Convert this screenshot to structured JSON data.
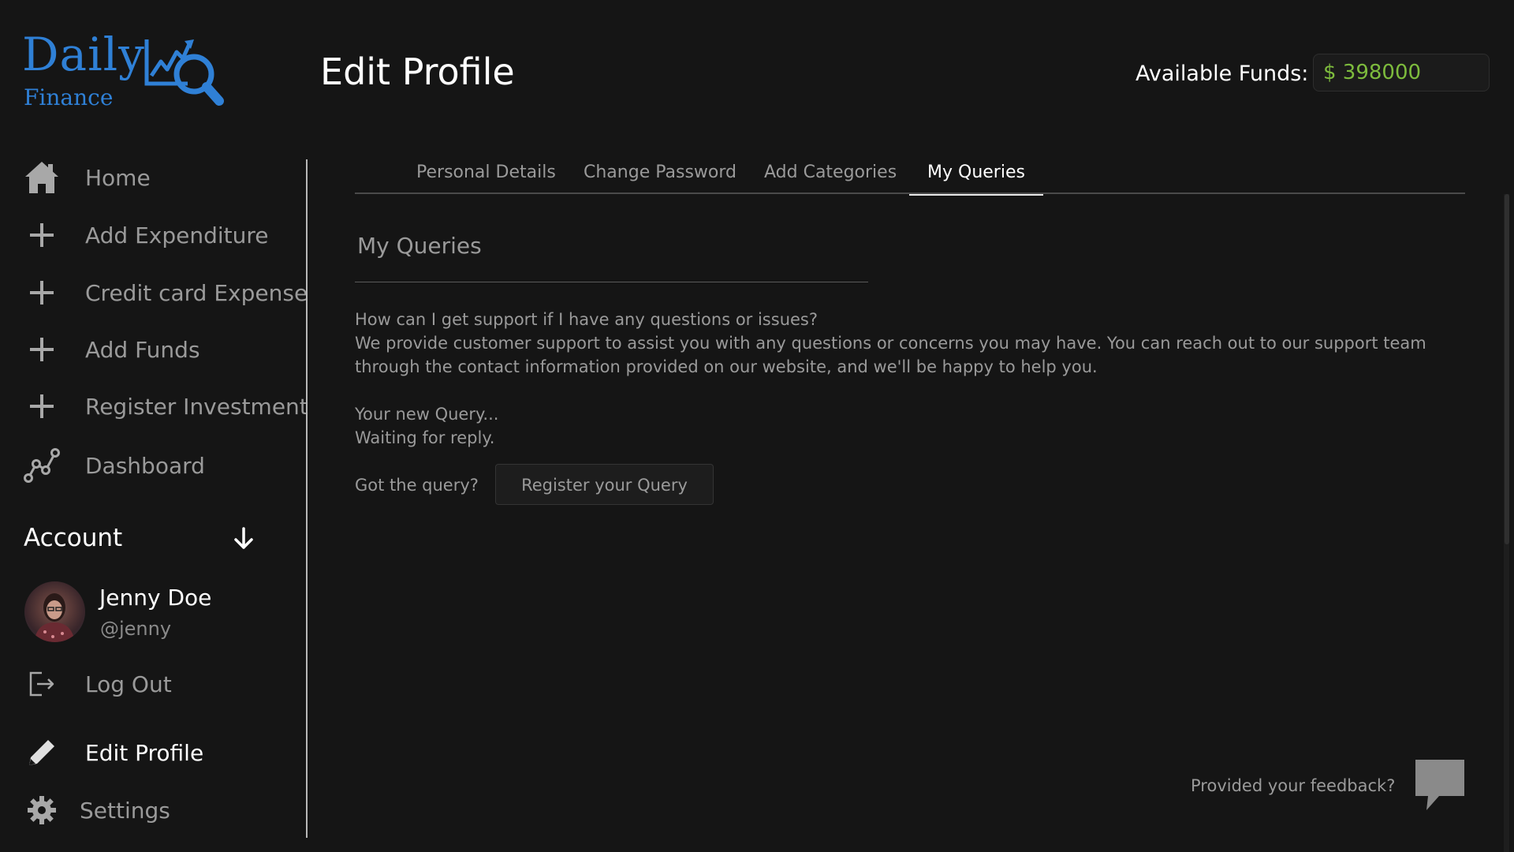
{
  "logo": {
    "line1": "Daily",
    "line2": "Finance"
  },
  "header": {
    "title": "Edit Profile",
    "funds_label": "Available Funds:",
    "funds_value": "$ 398000"
  },
  "sidebar": {
    "items": [
      {
        "label": "Home",
        "icon": "home-icon"
      },
      {
        "label": "Add Expenditure",
        "icon": "plus-icon"
      },
      {
        "label": "Credit card Expense",
        "icon": "plus-icon"
      },
      {
        "label": "Add Funds",
        "icon": "plus-icon"
      },
      {
        "label": "Register Investment",
        "icon": "plus-icon"
      },
      {
        "label": "Dashboard",
        "icon": "chart-line-icon"
      }
    ],
    "account": {
      "title": "Account",
      "user_name": "Jenny Doe",
      "user_handle": "@jenny",
      "logout": "Log Out",
      "edit_profile": "Edit Profile",
      "settings": "Settings"
    }
  },
  "tabs": [
    {
      "label": "Personal Details",
      "active": false
    },
    {
      "label": "Change Password",
      "active": false
    },
    {
      "label": "Add Categories",
      "active": false
    },
    {
      "label": "My Queries",
      "active": true
    }
  ],
  "queries": {
    "section_title": "My Queries",
    "faq_question": "How can I get support if I have any questions or issues?",
    "faq_answer": "We provide customer support to assist you with any questions or concerns you may have. You can reach out to our support team through the contact information provided on our website, and we'll be happy to help you.",
    "new_query": "Your new Query...",
    "status": "Waiting for reply.",
    "got_query": "Got the query?",
    "register_button": "Register your Query"
  },
  "feedback": {
    "text": "Provided your feedback?",
    "icon": "chat-bubble-icon"
  },
  "colors": {
    "background": "#151515",
    "brand": "#2f80d6",
    "funds": "#7dbb3d",
    "muted_text": "#9a9a9a",
    "active_text": "#ffffff"
  }
}
